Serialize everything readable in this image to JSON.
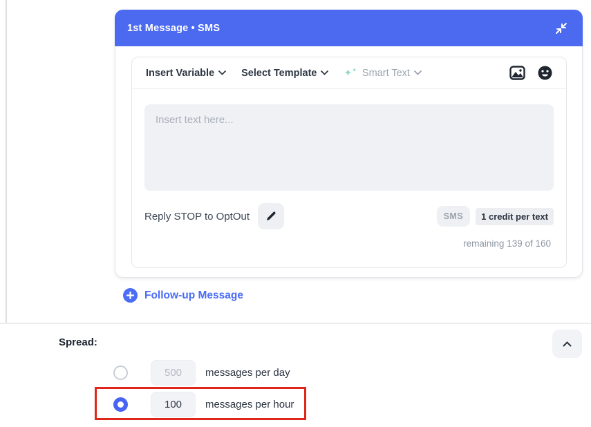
{
  "header": {
    "title": "1st Message • SMS"
  },
  "toolbar": {
    "insert_variable": "Insert Variable",
    "select_template": "Select Template",
    "smart_text": "Smart Text",
    "smart_text_sparkle": "sparkle-icon",
    "image_icon": "image-icon",
    "emoji_icon": "emoji-icon"
  },
  "editor": {
    "placeholder": "Insert text here..."
  },
  "message_footer": {
    "optout_label": "Reply STOP to OptOut",
    "edit_icon": "pencil-icon",
    "sms_badge": "SMS",
    "credit_badge": "1 credit per text",
    "remaining": "remaining 139 of 160"
  },
  "followup": {
    "label": "Follow-up Message",
    "icon": "plus-circle-icon"
  },
  "spread": {
    "label": "Spread:",
    "options": [
      {
        "value": "500",
        "unit": "messages per day",
        "selected": false
      },
      {
        "value": "100",
        "unit": "messages per hour",
        "selected": true,
        "highlighted": true
      }
    ]
  },
  "colors": {
    "header_blue": "#4b6af0",
    "link_blue": "#4a6cf7",
    "radio_blue": "#4765f2",
    "smart_text_teal": "#8fd9c6",
    "highlight_red": "#e0261a"
  }
}
